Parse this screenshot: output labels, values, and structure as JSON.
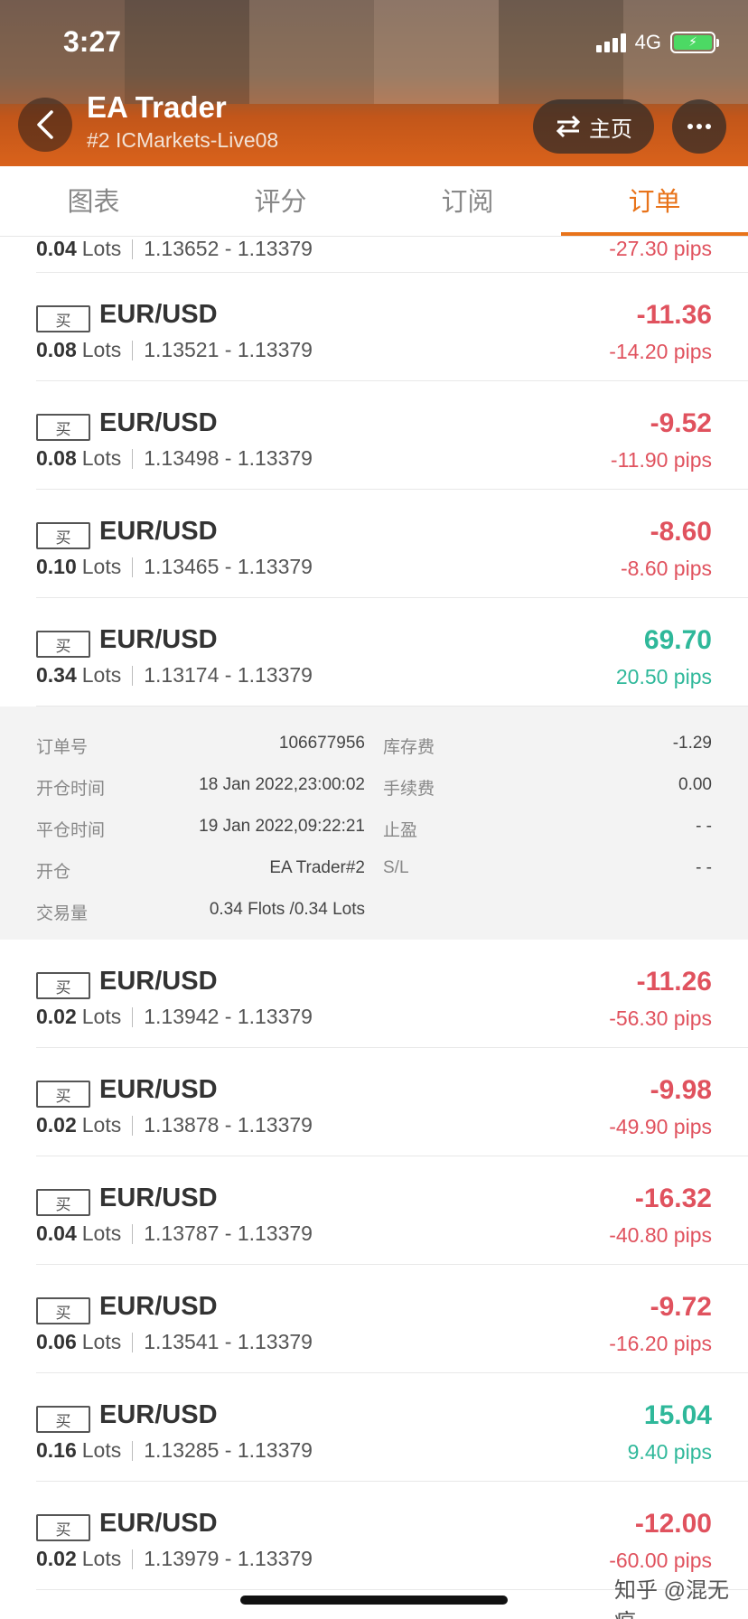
{
  "status_bar": {
    "time": "3:27",
    "network": "4G"
  },
  "header": {
    "title": "EA Trader",
    "subtitle": "#2 ICMarkets-Live08",
    "home_label": "主页"
  },
  "tabs": [
    {
      "label": "图表"
    },
    {
      "label": "评分"
    },
    {
      "label": "订阅"
    },
    {
      "label": "订单",
      "active": true
    }
  ],
  "partial_row": {
    "lots": "0.04",
    "unit": "Lots",
    "range": "1.13652 - 1.13379",
    "pips": "-27.30 pips"
  },
  "orders": [
    {
      "badge": "买",
      "pair": "EUR/USD",
      "lots": "0.08",
      "unit": "Lots",
      "range": "1.13521 - 1.13379",
      "profit": "-11.36",
      "pips": "-14.20 pips",
      "positive": false
    },
    {
      "badge": "买",
      "pair": "EUR/USD",
      "lots": "0.08",
      "unit": "Lots",
      "range": "1.13498 - 1.13379",
      "profit": "-9.52",
      "pips": "-11.90 pips",
      "positive": false
    },
    {
      "badge": "买",
      "pair": "EUR/USD",
      "lots": "0.10",
      "unit": "Lots",
      "range": "1.13465 - 1.13379",
      "profit": "-8.60",
      "pips": "-8.60 pips",
      "positive": false
    },
    {
      "badge": "买",
      "pair": "EUR/USD",
      "lots": "0.34",
      "unit": "Lots",
      "range": "1.13174 - 1.13379",
      "profit": "69.70",
      "pips": "20.50 pips",
      "positive": true
    }
  ],
  "details": {
    "order_no_label": "订单号",
    "order_no": "106677956",
    "swap_label": "库存费",
    "swap": "-1.29",
    "open_time_label": "开仓时间",
    "open_time": "18 Jan 2022,23:00:02",
    "fee_label": "手续费",
    "fee": "0.00",
    "close_time_label": "平仓时间",
    "close_time": "19 Jan 2022,09:22:21",
    "tp_label": "止盈",
    "tp": "- -",
    "open_label": "开仓",
    "open_value": "EA Trader#2",
    "sl_label": "S/L",
    "sl": "- -",
    "volume_label": "交易量",
    "volume": "0.34 Flots /0.34 Lots"
  },
  "orders2": [
    {
      "badge": "买",
      "pair": "EUR/USD",
      "lots": "0.02",
      "unit": "Lots",
      "range": "1.13942 - 1.13379",
      "profit": "-11.26",
      "pips": "-56.30 pips",
      "positive": false
    },
    {
      "badge": "买",
      "pair": "EUR/USD",
      "lots": "0.02",
      "unit": "Lots",
      "range": "1.13878 - 1.13379",
      "profit": "-9.98",
      "pips": "-49.90 pips",
      "positive": false
    },
    {
      "badge": "买",
      "pair": "EUR/USD",
      "lots": "0.04",
      "unit": "Lots",
      "range": "1.13787 - 1.13379",
      "profit": "-16.32",
      "pips": "-40.80 pips",
      "positive": false
    },
    {
      "badge": "买",
      "pair": "EUR/USD",
      "lots": "0.06",
      "unit": "Lots",
      "range": "1.13541 - 1.13379",
      "profit": "-9.72",
      "pips": "-16.20 pips",
      "positive": false
    },
    {
      "badge": "买",
      "pair": "EUR/USD",
      "lots": "0.16",
      "unit": "Lots",
      "range": "1.13285 - 1.13379",
      "profit": "15.04",
      "pips": "9.40 pips",
      "positive": true
    },
    {
      "badge": "买",
      "pair": "EUR/USD",
      "lots": "0.02",
      "unit": "Lots",
      "range": "1.13979 - 1.13379",
      "profit": "-12.00",
      "pips": "-60.00 pips",
      "positive": false
    }
  ],
  "watermark": "知乎 @混无痕",
  "colors": {
    "accent": "#e8731a",
    "negative": "#e0525e",
    "positive": "#2fb89a"
  }
}
